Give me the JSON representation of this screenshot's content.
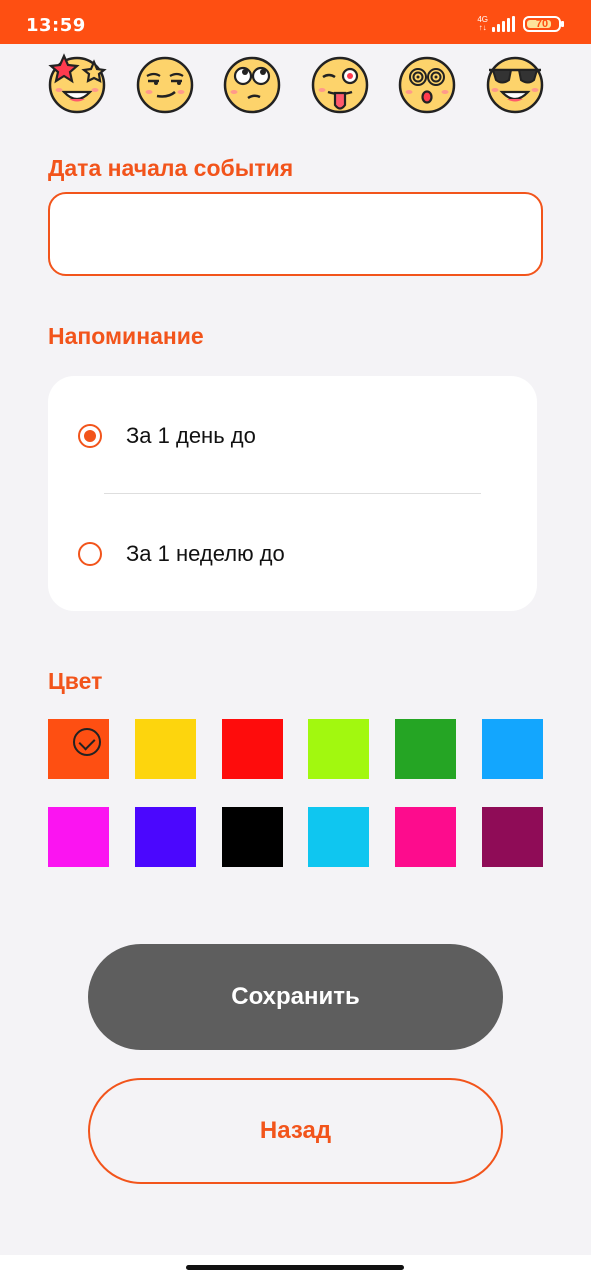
{
  "status_bar": {
    "time": "13:59",
    "network": "4G",
    "network_sub": "↑↓",
    "battery": "70",
    "background": "#fe4f12"
  },
  "emojis": [
    "star-eyes-emoji",
    "unamused-emoji",
    "eye-roll-emoji",
    "tongue-wink-emoji",
    "dizzy-emoji",
    "sunglasses-emoji"
  ],
  "date_section": {
    "label": "Дата начала события",
    "value": "",
    "placeholder": ""
  },
  "reminder_section": {
    "label": "Напоминание",
    "options": [
      {
        "label": "За 1 день до",
        "selected": true
      },
      {
        "label": "За 1 неделю до",
        "selected": false
      }
    ]
  },
  "color_section": {
    "label": "Цвет",
    "selected_index": 0,
    "colors": [
      "#fe4f12",
      "#fdd50d",
      "#fe0c0c",
      "#a2f80f",
      "#25a524",
      "#13a6fe",
      "#fb14f1",
      "#4b07fe",
      "#000000",
      "#0fc6f0",
      "#fd0c8d",
      "#8f0c57"
    ]
  },
  "actions": {
    "save": "Сохранить",
    "back": "Назад"
  },
  "accent_color": "#f2541b"
}
